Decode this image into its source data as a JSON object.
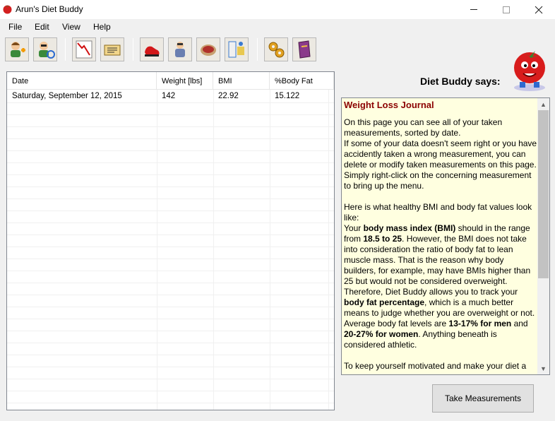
{
  "window": {
    "title": "Arun's Diet Buddy"
  },
  "menu": {
    "file": "File",
    "edit": "Edit",
    "view": "View",
    "help": "Help"
  },
  "toolbar": {
    "buttons": [
      "add-user-icon",
      "switch-user-icon",
      "weight-chart-icon",
      "journal-icon",
      "running-shoe-icon",
      "exercise-icon",
      "food-icon",
      "measure-icon",
      "settings-gears-icon",
      "book-icon"
    ]
  },
  "table": {
    "headers": [
      "Date",
      "Weight [lbs]",
      "BMI",
      "%Body Fat"
    ],
    "rows": [
      [
        "Saturday, September 12, 2015",
        "142",
        "22.92",
        "15.122"
      ]
    ]
  },
  "assistant": {
    "label": "Diet Buddy says:"
  },
  "journal": {
    "title": "Weight Loss Journal",
    "p1": "On this page you can see all of your taken measurements, sorted by date.",
    "p2": "If some of your data doesn't seem right or you have accidently taken a wrong measurement, you can delete or modify taken measurements on this page. Simply right-click on the concerning measurement to bring up the menu.",
    "p3": "Here is what healthy BMI and body fat values look like:",
    "p4a": "Your ",
    "p4b": "body mass index (BMI)",
    "p4c": " should in the range from ",
    "p4d": "18.5 to 25",
    "p4e": ". However, the BMI does not take into consideration the ratio of body fat to lean muscle mass. That is the reason why body builders, for example, may have BMIs higher than 25 but would not be considered overweight.",
    "p5a": "Therefore, Diet Buddy allows you to track your ",
    "p5b": "body fat percentage",
    "p5c": ", which is a much better means to judge whether you are overweight or not.",
    "p6a": "Average body fat levels are ",
    "p6b": "13-17% for men",
    "p6c": " and ",
    "p6d": "20-27% for women",
    "p6e": ". Anything beneath is considered athletic.",
    "p7": "To keep yourself motivated and make your diet a"
  },
  "actions": {
    "take_measurements": "Take Measurements"
  },
  "colors": {
    "journal_bg": "#ffffe0",
    "journal_title": "#8b0000"
  }
}
